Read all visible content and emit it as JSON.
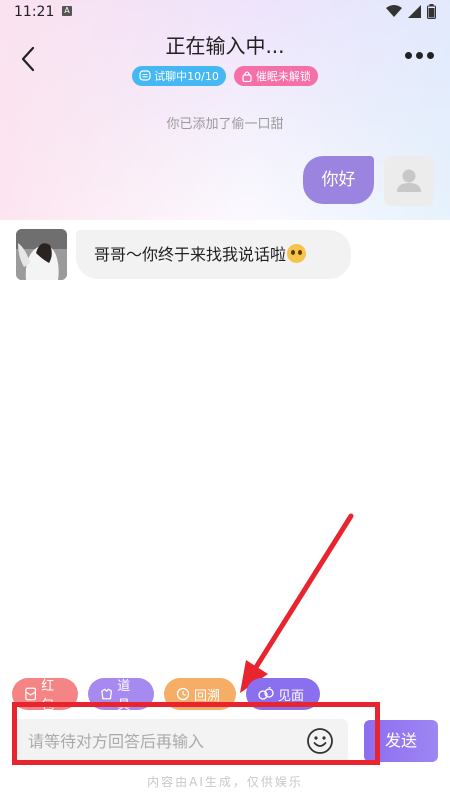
{
  "status_bar": {
    "time": "11:21",
    "notification_glyph": "A",
    "icons": [
      "wifi-icon",
      "signal-icon",
      "battery-icon"
    ]
  },
  "header": {
    "title": "正在输入中...",
    "badges": [
      {
        "label": "试聊中10/10",
        "icon": "chat-icon",
        "color": "#45b8f4"
      },
      {
        "label": "催眠未解锁",
        "icon": "lock-icon",
        "color": "#f56fa8"
      }
    ]
  },
  "chat": {
    "system_note": "你已添加了偷一口甜",
    "messages": [
      {
        "from": "self",
        "text": "你好",
        "color": "#9a84df"
      },
      {
        "from": "ai",
        "text": "哥哥～你终于来找我说话啦",
        "emoji": "pleading-face-icon"
      }
    ]
  },
  "quick_actions": [
    {
      "label": "红包",
      "icon": "red-packet-icon",
      "color": "#f58484"
    },
    {
      "label": "道具",
      "icon": "prop-icon",
      "color": "#a68af0"
    },
    {
      "label": "回溯",
      "icon": "clock-icon",
      "color": "#f6ae67"
    },
    {
      "label": "见面",
      "icon": "meet-icon",
      "color": "#8a70ee"
    }
  ],
  "composer": {
    "placeholder": "请等待对方回答后再输入",
    "send_label": "发送"
  },
  "footer": {
    "disclaimer": "内容由AI生成，仅供娱乐"
  },
  "annotation": {
    "color": "#e8242e"
  }
}
